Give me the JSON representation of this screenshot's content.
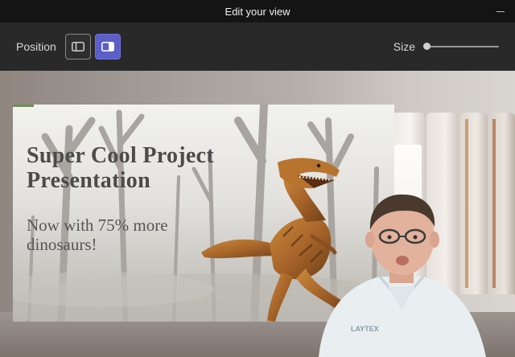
{
  "window": {
    "title": "Edit your view",
    "minimize_icon": "minimize-icon"
  },
  "toolbar": {
    "position_label": "Position",
    "position_options": [
      {
        "icon": "layout-left-panel-icon",
        "selected": false
      },
      {
        "icon": "layout-right-panel-icon",
        "selected": true
      }
    ],
    "size_label": "Size",
    "size_value": 0,
    "accent_color": "#5b5fc7"
  },
  "slide": {
    "title": "Super Cool Project Presentation",
    "subtitle": "Now with 75% more dinosaurs!"
  },
  "presenter": {
    "shirt_logo": "LAYTEX"
  }
}
